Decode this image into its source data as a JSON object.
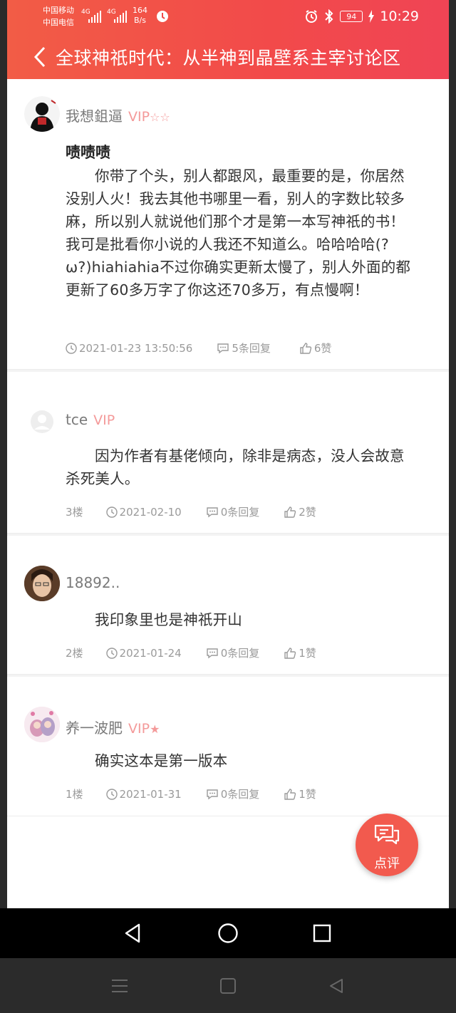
{
  "status_bar": {
    "carrier1": "中国移动",
    "carrier2": "中国电信",
    "net1": "4G",
    "net2": "4G",
    "speed_value": "164",
    "speed_unit": "B/s",
    "battery": "94",
    "time": "10:29"
  },
  "header": {
    "title": "全球神祇时代：从半神到晶壁系主宰讨论区",
    "back_icon": "chevron-left-icon"
  },
  "comments": [
    {
      "username": "我想鉏逼",
      "vip": "VIP",
      "stars": "☆☆",
      "title": "啧啧啧",
      "body": "你带了个头，别人都跟风，最重要的是，你居然没别人火！我去其他书哪里一看，别人的字数比较多麻，所以别人就说他们那个才是第一本写神祇的书！我可是批看你小说的人我还不知道么。哈哈哈哈(?ω?)hiahiahia不过你确实更新太慢了，别人外面的都更新了60多万字了你这还70多万，有点慢啊！",
      "floor": "",
      "date": "2021-01-23 13:50:56",
      "replies": "5条回复",
      "likes": "6赞"
    },
    {
      "username": "tce",
      "vip": "VIP",
      "stars": "",
      "body": "因为作者有基佬倾向，除非是病态，没人会故意杀死美人。",
      "floor": "3楼",
      "date": "2021-02-10",
      "replies": "0条回复",
      "likes": "2赞"
    },
    {
      "username": "18892..",
      "vip": "",
      "stars": "",
      "body": "我印象里也是神祇开山",
      "floor": "2楼",
      "date": "2021-01-24",
      "replies": "0条回复",
      "likes": "1赞"
    },
    {
      "username": "养一波肥",
      "vip": "VIP",
      "stars": "★",
      "body": "确实这本是第一版本",
      "floor": "1楼",
      "date": "2021-01-31",
      "replies": "0条回复",
      "likes": "1赞"
    }
  ],
  "fab": {
    "label": "点评",
    "icon": "comment-bubbles-icon"
  },
  "nav": {
    "back_icon": "back-triangle-icon",
    "home_icon": "home-circle-icon",
    "recents_icon": "recents-square-icon",
    "menu_icon": "menu-lines-icon",
    "square_icon": "square-outline-icon",
    "back2_icon": "back-triangle-outline-icon"
  },
  "colors": {
    "header": "#f24a4a",
    "vip": "#f49a9a",
    "fab": "#f25a4e"
  }
}
